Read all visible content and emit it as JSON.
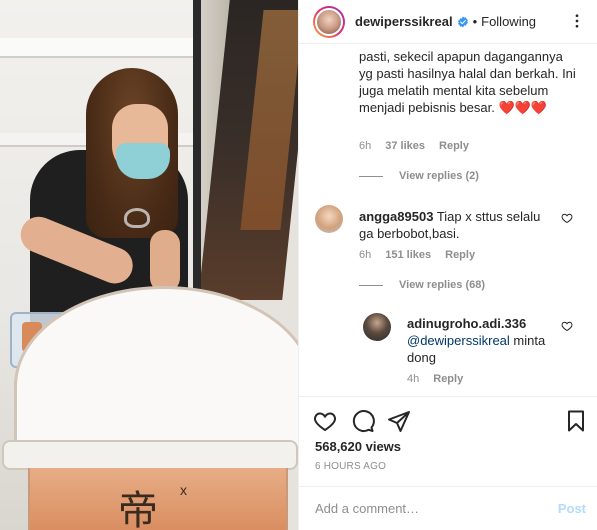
{
  "header": {
    "username": "dewiperssikreal",
    "separator": "•",
    "follow_status": "Following",
    "verified_icon": "verified-badge-icon",
    "more_icon": "more-options-icon"
  },
  "comments": [
    {
      "id": "caption-continuation",
      "text": "pasti, sekecil apapun dagangannya yg pasti hasilnya halal dan berkah. Ini juga melatih mental kita sebelum menjadi pebisnis besar.",
      "emoji": "❤️❤️❤️",
      "time": "6h",
      "likes": "37 likes",
      "reply": "Reply",
      "view_replies": "View replies (2)"
    },
    {
      "id": "comment-angga",
      "username": "angga89503",
      "text": "Tiap x sttus selalu ga berbobot,basi.",
      "time": "6h",
      "likes": "151 likes",
      "reply": "Reply",
      "view_replies": "View replies (68)"
    },
    {
      "id": "reply-adinugroho",
      "username": "adinugroho.adi.336",
      "mention": "@dewiperssikreal",
      "text": "minta dong",
      "time": "4h",
      "reply": "Reply"
    }
  ],
  "actions": {
    "like_icon": "heart-icon",
    "comment_icon": "comment-icon",
    "share_icon": "share-icon",
    "save_icon": "bookmark-icon",
    "views": "568,620 views",
    "time_ago": "6 HOURS AGO"
  },
  "add_comment": {
    "placeholder": "Add a comment…",
    "post_label": "Post"
  },
  "colors": {
    "link": "#00376b",
    "muted": "#8e8e8e",
    "post_disabled": "#b3dbff",
    "verified": "#3897f0",
    "heart": "#ed4956"
  }
}
